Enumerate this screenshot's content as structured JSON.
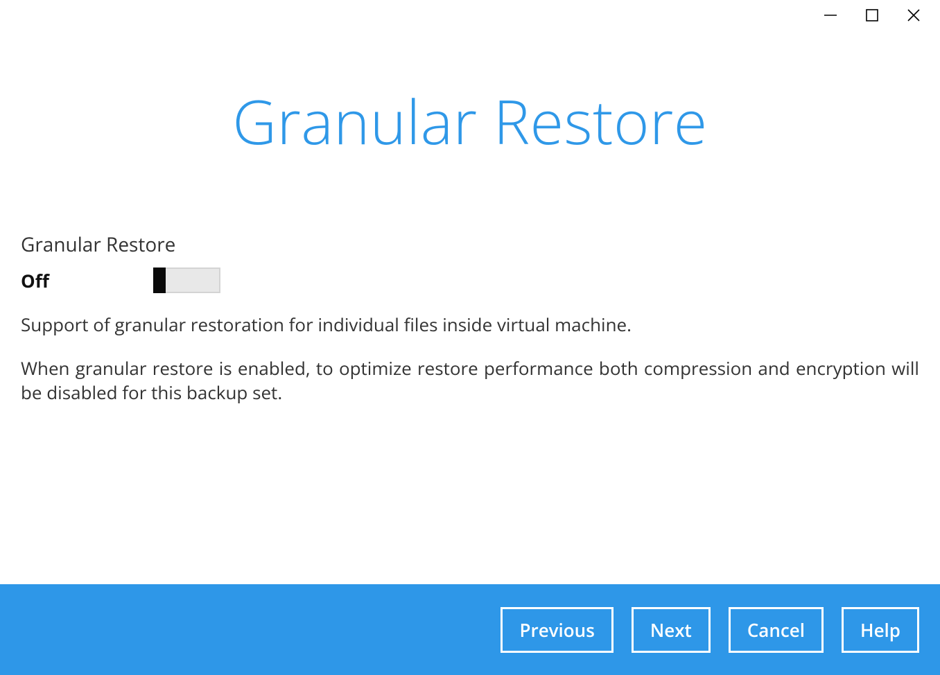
{
  "window": {
    "minimize": "minimize",
    "maximize": "maximize",
    "close": "close"
  },
  "page": {
    "title": "Granular Restore"
  },
  "section": {
    "label": "Granular Restore",
    "toggle_state": "Off",
    "description1": "Support of granular restoration for individual files inside virtual machine.",
    "description2": "When granular restore is enabled, to optimize restore performance both compression and encryption will be disabled for this backup set."
  },
  "footer": {
    "previous": "Previous",
    "next": "Next",
    "cancel": "Cancel",
    "help": "Help"
  }
}
